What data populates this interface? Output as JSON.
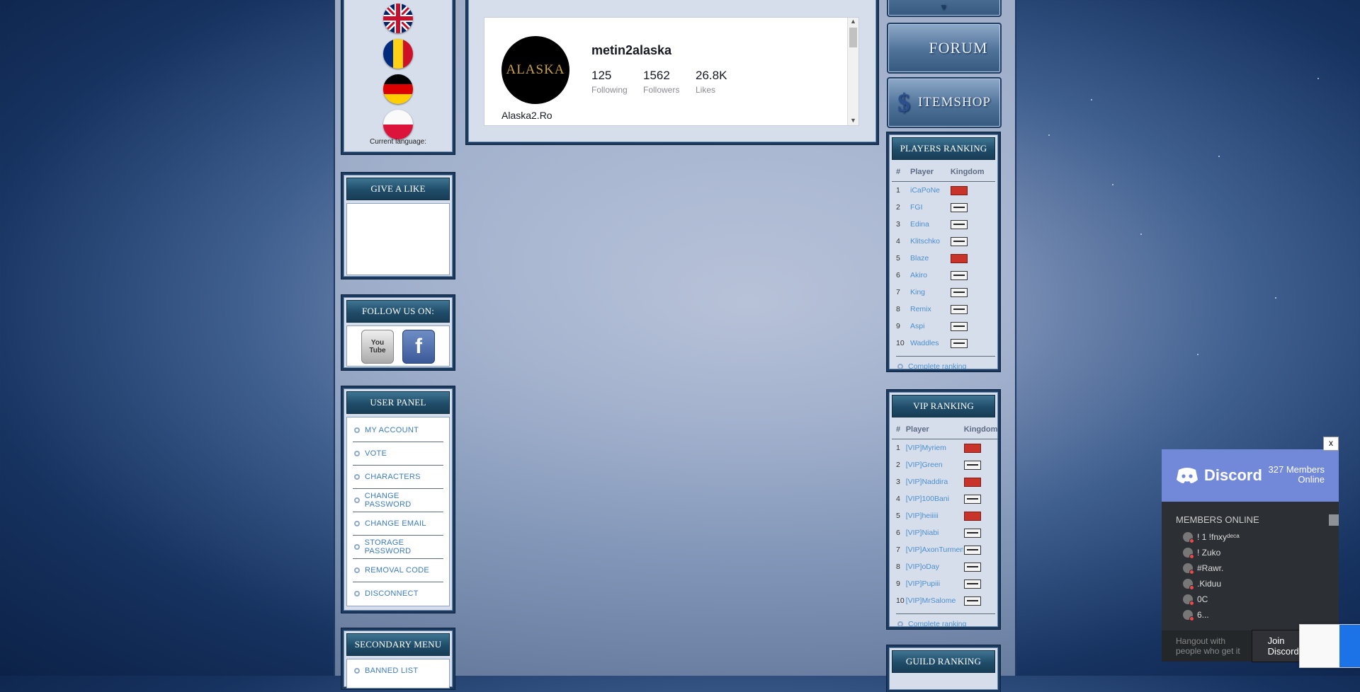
{
  "languages": {
    "flags": [
      {
        "name": "uk-flag-icon",
        "colors": [
          "#012169",
          "#ffffff",
          "#c8102e"
        ]
      },
      {
        "name": "romania-flag-icon",
        "colors": [
          "#002b7f",
          "#fcd116",
          "#ce1126"
        ]
      },
      {
        "name": "germany-flag-icon",
        "colors": [
          "#000000",
          "#dd0000",
          "#ffce00"
        ]
      },
      {
        "name": "poland-flag-icon",
        "colors": [
          "#ffffff",
          "#dc143c"
        ]
      }
    ],
    "current_label": "Current language:"
  },
  "give_like": {
    "title": "GIVE A LIKE"
  },
  "follow": {
    "title": "FOLLOW US ON:",
    "youtube_label": "You Tube",
    "facebook_label": "f"
  },
  "user_panel": {
    "title": "USER PANEL",
    "items": [
      "MY ACCOUNT",
      "VOTE",
      "CHARACTERS",
      "CHANGE PASSWORD",
      "CHANGE EMAIL",
      "STORAGE PASSWORD",
      "REMOVAL CODE",
      "DISCONNECT"
    ]
  },
  "secondary_menu": {
    "title": "SECONDARY MENU",
    "items": [
      "BANNED LIST"
    ]
  },
  "tiktok": {
    "username": "metin2alaska",
    "logo_text": "ALASKA",
    "handle": "Alaska2.Ro",
    "stats": [
      {
        "value": "125",
        "label": "Following"
      },
      {
        "value": "1562",
        "label": "Followers"
      },
      {
        "value": "26.8K",
        "label": "Likes"
      }
    ]
  },
  "right_buttons": {
    "forum": "FORUM",
    "itemshop": "ITEMSHOP"
  },
  "players_ranking": {
    "title": "PLAYERS RANKING",
    "headers": [
      "#",
      "Player",
      "Kingdom"
    ],
    "rows": [
      {
        "n": "1",
        "player": "iCaPoNe",
        "kingdom": "red"
      },
      {
        "n": "2",
        "player": "FGI",
        "kingdom": "white"
      },
      {
        "n": "3",
        "player": "Edina",
        "kingdom": "white"
      },
      {
        "n": "4",
        "player": "Klitschko",
        "kingdom": "white"
      },
      {
        "n": "5",
        "player": "Blaze",
        "kingdom": "red"
      },
      {
        "n": "6",
        "player": "Akiro",
        "kingdom": "white"
      },
      {
        "n": "7",
        "player": "King",
        "kingdom": "white"
      },
      {
        "n": "8",
        "player": "Remix",
        "kingdom": "white"
      },
      {
        "n": "9",
        "player": "Aspi",
        "kingdom": "white"
      },
      {
        "n": "10",
        "player": "Waddles",
        "kingdom": "white"
      }
    ],
    "complete": "Complete ranking"
  },
  "vip_ranking": {
    "title": "VIP RANKING",
    "headers": [
      "#",
      "Player",
      "Kingdom"
    ],
    "rows": [
      {
        "n": "1",
        "player": "[VIP]Myriem",
        "kingdom": "red"
      },
      {
        "n": "2",
        "player": "[VIP]Green",
        "kingdom": "white"
      },
      {
        "n": "3",
        "player": "[VIP]Naddira",
        "kingdom": "red"
      },
      {
        "n": "4",
        "player": "[VIP]100Bani",
        "kingdom": "white"
      },
      {
        "n": "5",
        "player": "[VIP]heiiiii",
        "kingdom": "red"
      },
      {
        "n": "6",
        "player": "[VIP]Niabi",
        "kingdom": "white"
      },
      {
        "n": "7",
        "player": "[VIP]AxonTurmenti",
        "kingdom": "white"
      },
      {
        "n": "8",
        "player": "[VIP]oDay",
        "kingdom": "white"
      },
      {
        "n": "9",
        "player": "[VIP]Pupiii",
        "kingdom": "white"
      },
      {
        "n": "10",
        "player": "[VIP]MrSalome",
        "kingdom": "white"
      }
    ],
    "complete": "Complete ranking"
  },
  "guild_ranking": {
    "title": "GUILD RANKING"
  },
  "discord": {
    "brand": "Discord",
    "members_count": "327 Members Online",
    "close": "x",
    "members_title": "MEMBERS ONLINE",
    "members": [
      "! 1 !fnxyᵈᵉᶜᵃ",
      "! Zuko",
      "#Rawr.",
      ".Kiduu",
      "0C",
      "6..."
    ],
    "hint": "Hangout with people who get it",
    "join": "Join Discord"
  }
}
